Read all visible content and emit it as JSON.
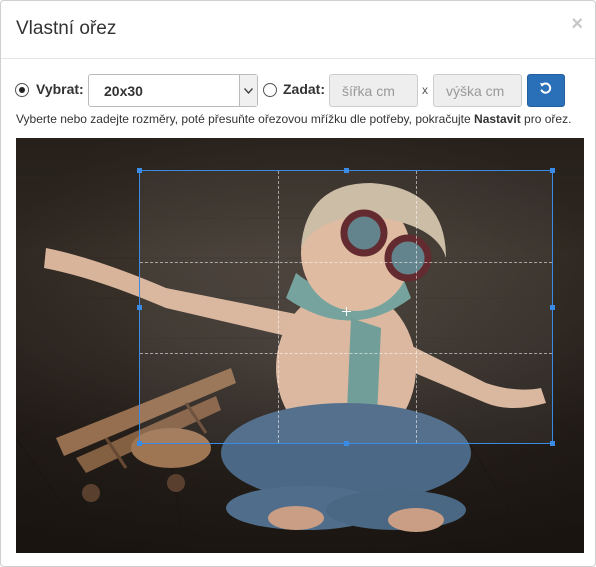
{
  "dialog": {
    "title": "Vlastní ořez",
    "close": "×"
  },
  "controls": {
    "select_label": "Vybrat:",
    "select_value": "20x30",
    "enter_label": "Zadat:",
    "width_placeholder": "šířka cm",
    "height_placeholder": "výška cm",
    "separator": "x"
  },
  "help": {
    "text_before": "Vyberte nebo zadejte rozměry, poté přesuňte ořezovou mřížku dle potřeby, pokračujte ",
    "bold": "Nastavit",
    "text_after": " pro ořez."
  },
  "icons": {
    "reset": "reset-icon",
    "chevron": "chevron-down-icon",
    "center": "crosshair-icon"
  },
  "colors": {
    "accent": "#2a70b8",
    "crop_border": "#3a8be6"
  }
}
